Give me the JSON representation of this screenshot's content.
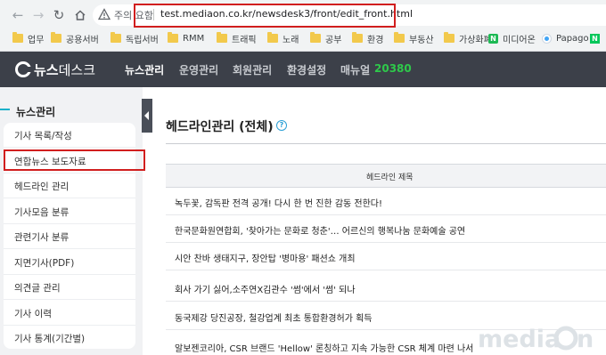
{
  "browser": {
    "security_label": "주의 요함",
    "url": "test.mediaon.co.kr/newsdesk3/front/edit_front.html",
    "bookmarks": [
      {
        "label": "업무",
        "icon": "folder-icon"
      },
      {
        "label": "공용서버",
        "icon": "folder-icon"
      },
      {
        "label": "독립서버",
        "icon": "folder-icon"
      },
      {
        "label": "RMM",
        "icon": "folder-icon"
      },
      {
        "label": "트래픽",
        "icon": "folder-icon"
      },
      {
        "label": "노래",
        "icon": "folder-icon"
      },
      {
        "label": "공부",
        "icon": "folder-icon"
      },
      {
        "label": "환경",
        "icon": "folder-icon"
      },
      {
        "label": "부동산",
        "icon": "folder-icon"
      },
      {
        "label": "가상화폐",
        "icon": "folder-icon"
      },
      {
        "label": "미디어온",
        "icon": "n-logo-icon"
      },
      {
        "label": "Papago",
        "icon": "papago-icon"
      },
      {
        "label": "N",
        "icon": "naver-icon"
      }
    ]
  },
  "site": {
    "logo_bold": "뉴스",
    "logo_light": "데스크",
    "nav": [
      "뉴스관리",
      "운영관리",
      "회원관리",
      "환경설정",
      "매뉴얼"
    ],
    "nav_count": "20380"
  },
  "sidebar": {
    "title": "뉴스관리",
    "items": [
      "기사 목록/작성",
      "연합뉴스 보도자료",
      "헤드라인 관리",
      "기사모음 분류",
      "관련기사 분류",
      "지면기사(PDF)",
      "의견글 관리",
      "기사 이력",
      "기사 통계(기간별)"
    ]
  },
  "main": {
    "title": "헤드라인관리 (전체)",
    "column_header": "헤드라인 제목",
    "rows": [
      "녹두꽃, 감독판 전격 공개! 다시 한 번 진한 감동 전한다!",
      "한국문화원연합회, '찾아가는 문화로 청춘'… 어르신의 행복나눔 문화예술 공연",
      "시안 찬바 생태지구, 장안탑 '병마용' 패션쇼 개최",
      "회사 가기 싫어,소주연X김관수 '썸'에서 '썸' 되나",
      "동국제강 당진공장, 철강업계 최초 통합환경허가 획득",
      "알보젠코리아, CSR 브랜드 'Hellow' 론칭하고 지속 가능한 CSR 체계 마련 나서"
    ]
  },
  "watermark": "mediaon",
  "colors": {
    "header_bg": "#3c4049",
    "accent_green": "#2ec94a",
    "highlight_red": "#d11e1e",
    "sidebar_accent": "#1ab0c9"
  }
}
